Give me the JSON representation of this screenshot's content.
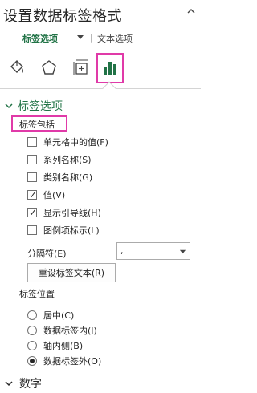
{
  "pane": {
    "title": "设置数据标签格式"
  },
  "tabs": {
    "active": "标签选项",
    "separator": "|",
    "other": "文本选项"
  },
  "icons": [
    "fill-line-icon",
    "effects-icon",
    "size-properties-icon",
    "label-options-icon"
  ],
  "section": {
    "title": "标签选项",
    "includes_label": "标签包括",
    "checkboxes": [
      {
        "label": "单元格中的值(F)",
        "checked": false
      },
      {
        "label": "系列名称(S)",
        "checked": false
      },
      {
        "label": "类别名称(G)",
        "checked": false
      },
      {
        "label": "值(V)",
        "checked": true
      },
      {
        "label": "显示引导线(H)",
        "checked": true
      },
      {
        "label": "图例项标示(L)",
        "checked": false
      }
    ],
    "separator_label": "分隔符(E)",
    "separator_value": ",",
    "reset_button": "重设标签文本(R)",
    "position_label": "标签位置",
    "positions": [
      {
        "label": "居中(C)",
        "selected": false
      },
      {
        "label": "数据标签内(I)",
        "selected": false
      },
      {
        "label": "轴内侧(B)",
        "selected": false
      },
      {
        "label": "数据标签外(O)",
        "selected": true
      }
    ]
  },
  "number_section": {
    "title": "数字"
  },
  "colors": {
    "accent": "#217346",
    "highlight": "#e03aa8"
  }
}
